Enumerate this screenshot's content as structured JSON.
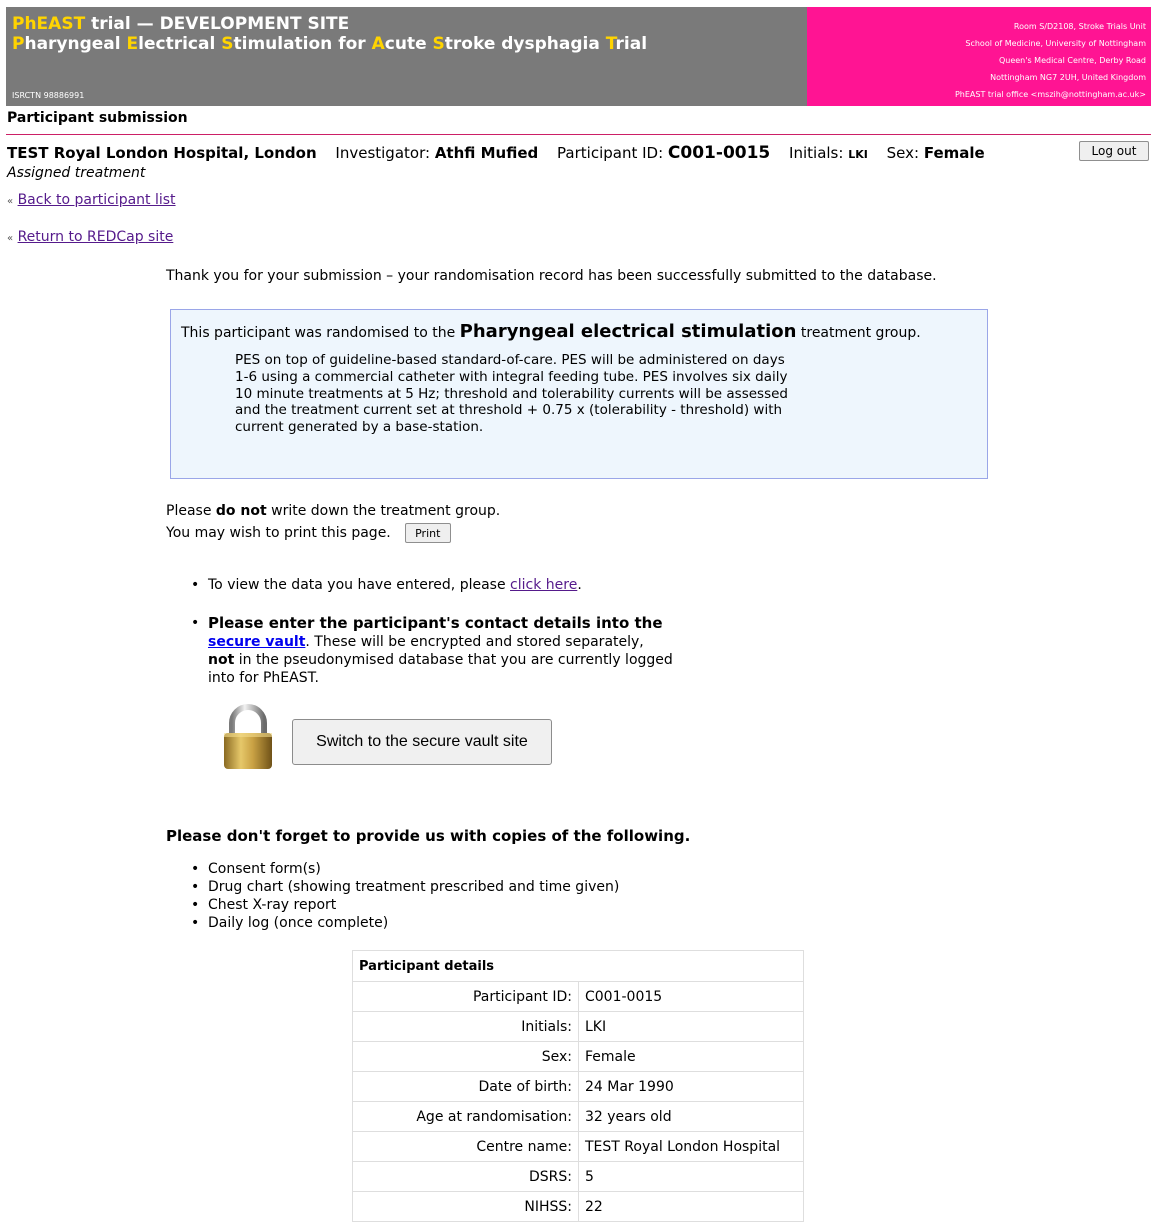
{
  "banner": {
    "title_line1_hl": "PhEAST",
    "title_line1_rest": " trial — DEVELOPMENT SITE",
    "title_line2": [
      {
        "hl": "P",
        "rest": "haryngeal "
      },
      {
        "hl": "E",
        "rest": "lectrical "
      },
      {
        "hl": "S",
        "rest": "timulation for "
      },
      {
        "hl": "A",
        "rest": "cute "
      },
      {
        "hl": "S",
        "rest": "troke dysphagia "
      },
      {
        "hl": "T",
        "rest": "rial"
      }
    ],
    "isrctn": "ISRCTN 98886991",
    "address": [
      "Room S/D2108, Stroke Trials Unit",
      "School of Medicine, University of Nottingham",
      "Queen's Medical Centre, Derby Road",
      "Nottingham NG7 2UH, United Kingdom",
      "PhEAST trial office <mszih@nottingham.ac.uk>"
    ],
    "colors": {
      "left": "#7a7a7a",
      "right": "#ff1493",
      "highlight": "#ffd400"
    }
  },
  "page_subtitle": "Participant submission",
  "info": {
    "site": "TEST Royal London Hospital, London",
    "investigator_label": "Investigator:",
    "investigator": "Athfi Mufied",
    "pid_label": "Participant ID:",
    "pid": "C001-0015",
    "initials_label": "Initials:",
    "initials": "LKI",
    "sex_label": "Sex:",
    "sex": "Female",
    "logout": "Log out"
  },
  "assigned": "Assigned treatment",
  "nav": {
    "back": "Back to participant list",
    "redcap": "Return to REDCap site",
    "chevron": "«"
  },
  "thanks": "Thank you for your submission – your randomisation record has been successfully submitted to the database.",
  "randomised": {
    "prefix": "This participant was randomised to the",
    "group": "Pharyngeal electrical stimulation",
    "suffix": "treatment group.",
    "description": "PES on top of guideline-based standard-of-care. PES will be administered on days 1-6 using a commercial catheter with integral feeding tube. PES involves six daily 10 minute treatments at 5 Hz; threshold and tolerability currents will be assessed and the treatment current set at threshold + 0.75 x (tolerability - threshold) with current generated by a base-station."
  },
  "note": {
    "please": "Please",
    "do_not": "do not",
    "rest": "write down the treatment group.",
    "print_text": "You may wish to print this page.",
    "print_btn": "Print"
  },
  "view_data": {
    "prefix": "To view the data you have entered, please",
    "link": "click here",
    "suffix": "."
  },
  "vault": {
    "lead": "Please enter the participant's contact details into the",
    "link": "secure vault",
    "after_link": ". These will be encrypted and stored separately,",
    "not": "not",
    "rest": "in the pseudonymised database that you are currently logged into for PhEAST.",
    "button": "Switch to the secure vault site"
  },
  "forget": {
    "heading": "Please don't forget to provide us with copies of the following.",
    "items": [
      "Consent form(s)",
      "Drug chart (showing treatment prescribed and time given)",
      "Chest X-ray report",
      "Daily log (once complete)"
    ]
  },
  "details": {
    "heading": "Participant details",
    "rows": [
      {
        "k": "Participant ID:",
        "v": "C001-0015"
      },
      {
        "k": "Initials:",
        "v": "LKI"
      },
      {
        "k": "Sex:",
        "v": "Female"
      },
      {
        "k": "Date of birth:",
        "v": "24 Mar 1990"
      },
      {
        "k": "Age at randomisation:",
        "v": "32 years old"
      },
      {
        "k": "Centre name:",
        "v": "TEST Royal London Hospital"
      },
      {
        "k": "DSRS:",
        "v": "5"
      },
      {
        "k": "NIHSS:",
        "v": "22"
      }
    ]
  }
}
